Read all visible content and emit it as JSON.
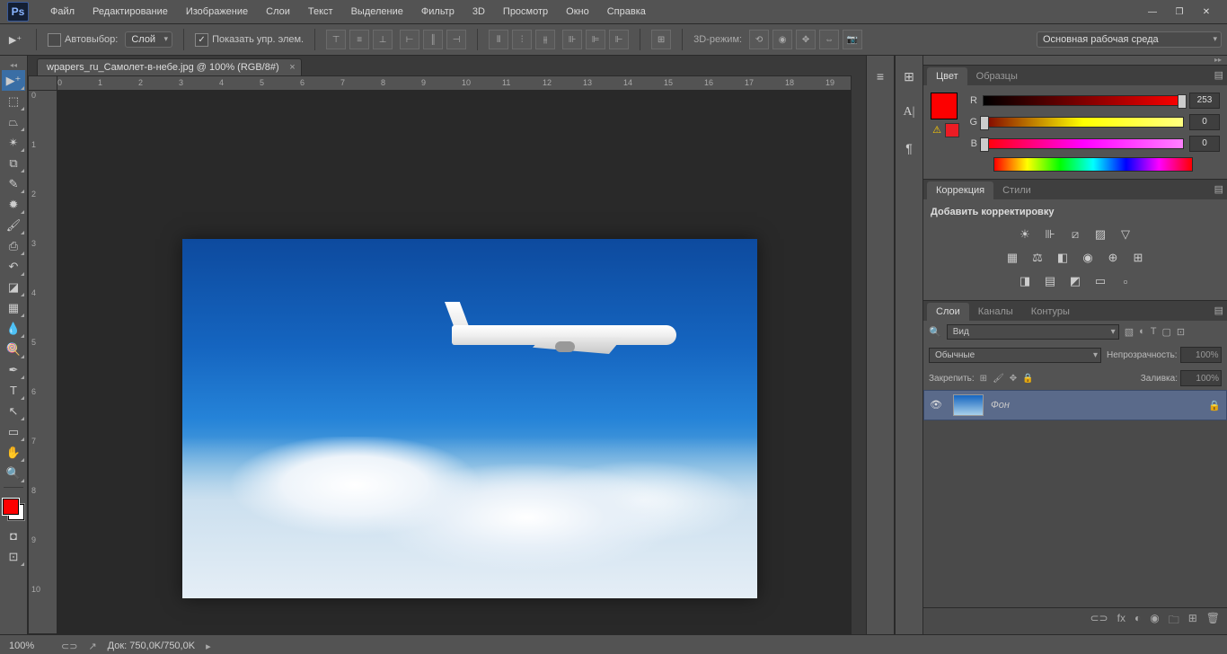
{
  "app": {
    "logo": "Ps"
  },
  "menu": [
    "Файл",
    "Редактирование",
    "Изображение",
    "Слои",
    "Текст",
    "Выделение",
    "Фильтр",
    "3D",
    "Просмотр",
    "Окно",
    "Справка"
  ],
  "options": {
    "autoselect": "Автовыбор:",
    "autoselect_value": "Слой",
    "show_controls": "Показать упр. элем.",
    "mode3d": "3D-режим:",
    "workspace": "Основная рабочая среда"
  },
  "document": {
    "tab": "wpapers_ru_Самолет-в-небе.jpg @ 100% (RGB/8#)",
    "ruler_h": [
      "0",
      "1",
      "2",
      "3",
      "4",
      "5",
      "6",
      "7",
      "8",
      "9",
      "10",
      "11",
      "12",
      "13",
      "14",
      "15",
      "16",
      "17",
      "18",
      "19"
    ],
    "ruler_v": [
      "0",
      "1",
      "2",
      "3",
      "4",
      "5",
      "6",
      "7",
      "8",
      "9",
      "10"
    ]
  },
  "panels": {
    "color": {
      "tabs": [
        "Цвет",
        "Образцы"
      ],
      "channels": [
        {
          "label": "R",
          "value": "253",
          "thumb": 99
        },
        {
          "label": "G",
          "value": "0",
          "thumb": 0
        },
        {
          "label": "B",
          "value": "0",
          "thumb": 0
        }
      ]
    },
    "adjust": {
      "tabs": [
        "Коррекция",
        "Стили"
      ],
      "title": "Добавить корректировку"
    },
    "layers": {
      "tabs": [
        "Слои",
        "Каналы",
        "Контуры"
      ],
      "filter_label": "Вид",
      "blend": "Обычные",
      "opacity_label": "Непрозрачность:",
      "opacity_value": "100%",
      "lock_label": "Закрепить:",
      "fill_label": "Заливка:",
      "fill_value": "100%",
      "layer_name": "Фон"
    }
  },
  "status": {
    "zoom": "100%",
    "doc_label": "Док:",
    "doc_size": "750,0K/750,0K"
  }
}
